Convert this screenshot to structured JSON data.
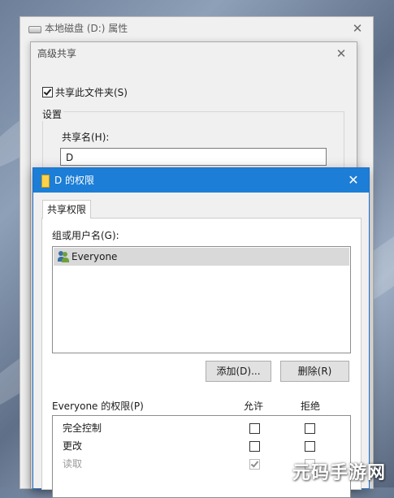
{
  "properties_window": {
    "title": "本地磁盘 (D:) 属性",
    "icon": "drive-icon"
  },
  "advanced_sharing": {
    "title": "高级共享",
    "share_checkbox_label": "共享此文件夹(S)",
    "share_checkbox_checked": true,
    "settings_label": "设置",
    "share_name_label": "共享名(H):",
    "share_name_value": "D"
  },
  "permissions_window": {
    "title": "D 的权限",
    "icon": "folder-icon",
    "tab_label": "共享权限",
    "group_label": "组或用户名(G):",
    "users": [
      "Everyone"
    ],
    "add_button": "添加(D)...",
    "remove_button": "删除(R)",
    "perm_for_label": "Everyone 的权限(P)",
    "allow_header": "允许",
    "deny_header": "拒绝",
    "permissions": [
      {
        "name": "完全控制",
        "allow": false,
        "deny": false
      },
      {
        "name": "更改",
        "allow": false,
        "deny": false
      },
      {
        "name": "读取",
        "allow": true,
        "deny": false
      }
    ]
  },
  "close_glyph": "✕",
  "watermark": "元码手游网",
  "colors": {
    "titlebar_active": "#1c7ed6",
    "folder": "#ffd24a"
  }
}
